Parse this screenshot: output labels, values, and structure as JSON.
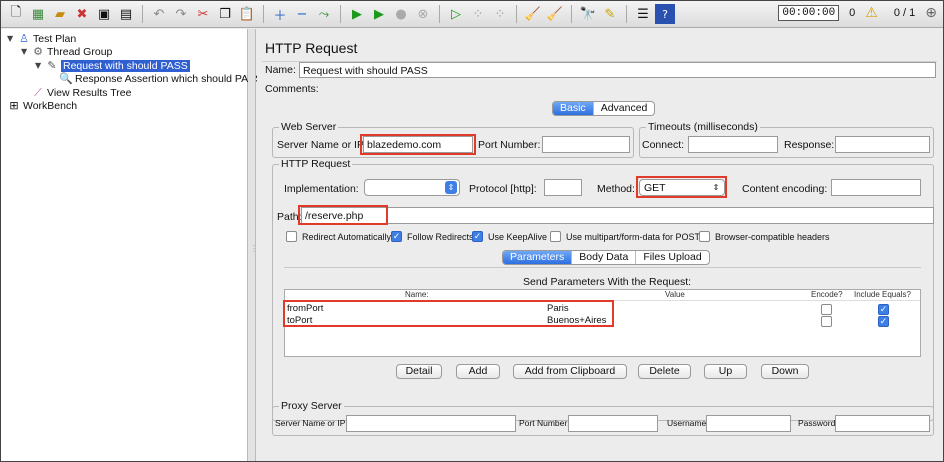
{
  "toolbar": {
    "icons": [
      "new-icon",
      "templates-icon",
      "open-icon",
      "close-icon",
      "save-icon",
      "save-as-icon",
      "undo-icon",
      "redo-icon",
      "cut-icon",
      "copy-icon",
      "paste-icon",
      "expand-icon",
      "collapse-icon",
      "toggle-icon",
      "start-icon",
      "start-no-pause-icon",
      "stop-icon",
      "shutdown-icon",
      "remote-start-icon",
      "remote-stop-icon",
      "remote-shutdown-icon",
      "clear-icon",
      "clear-all-icon",
      "search-icon",
      "reset-search-icon",
      "function-helper-icon",
      "help-icon"
    ],
    "timer": "00:00:00",
    "warning_count": "0",
    "threads": "0 / 1"
  },
  "tree": [
    {
      "label": "Test Plan",
      "icon": "test-plan-icon"
    },
    {
      "label": "Thread Group",
      "icon": "gear-icon"
    },
    {
      "label": "Request with should PASS",
      "icon": "pipette-icon"
    },
    {
      "label": "Response Assertion which should PASS",
      "icon": "magnifier-icon"
    },
    {
      "label": "View Results Tree",
      "icon": "chart-icon"
    },
    {
      "label": "WorkBench",
      "icon": "workbench-icon"
    }
  ],
  "panel": {
    "title": "HTTP Request",
    "name_label": "Name:",
    "name_value": "Request with should PASS",
    "comments_label": "Comments:",
    "tabs": {
      "basic": "Basic",
      "advanced": "Advanced"
    },
    "web_server": {
      "title": "Web Server",
      "server_label": "Server Name or IP:",
      "server_value": "blazedemo.com",
      "port_label": "Port Number:",
      "port_value": ""
    },
    "timeouts": {
      "title": "Timeouts (milliseconds)",
      "connect_label": "Connect:",
      "response_label": "Response:"
    },
    "http_request": {
      "title": "HTTP Request",
      "implementation_label": "Implementation:",
      "implementation_value": "",
      "protocol_label": "Protocol [http]:",
      "protocol_value": "",
      "method_label": "Method:",
      "method_value": "GET",
      "encoding_label": "Content encoding:",
      "encoding_value": "",
      "path_label": "Path:",
      "path_value": "/reserve.php"
    },
    "checkboxes": [
      {
        "label": "Redirect Automatically",
        "checked": false
      },
      {
        "label": "Follow Redirects",
        "checked": true
      },
      {
        "label": "Use KeepAlive",
        "checked": true
      },
      {
        "label": "Use multipart/form-data for POST",
        "checked": false
      },
      {
        "label": "Browser-compatible headers",
        "checked": false
      }
    ],
    "subtabs": {
      "parameters": "Parameters",
      "body": "Body Data",
      "files": "Files Upload"
    },
    "params_title": "Send Parameters With the Request:",
    "params_columns": {
      "name": "Name:",
      "value": "Value",
      "encode": "Encode?",
      "include": "Include Equals?"
    },
    "params_rows": [
      {
        "name": "fromPort",
        "value": "Paris",
        "encode": false,
        "include": true
      },
      {
        "name": "toPort",
        "value": "Buenos+Aires",
        "encode": false,
        "include": true
      }
    ],
    "buttons": {
      "detail": "Detail",
      "add": "Add",
      "add_clipboard": "Add from Clipboard",
      "delete": "Delete",
      "up": "Up",
      "down": "Down"
    },
    "proxy": {
      "title": "Proxy Server",
      "server_label": "Server Name or IP:",
      "port_label": "Port Number:",
      "username_label": "Username",
      "password_label": "Password"
    }
  },
  "colors": {
    "highlight": "#e23a2a",
    "selection": "#2f5fd0",
    "accent": "#3d7fe6"
  }
}
